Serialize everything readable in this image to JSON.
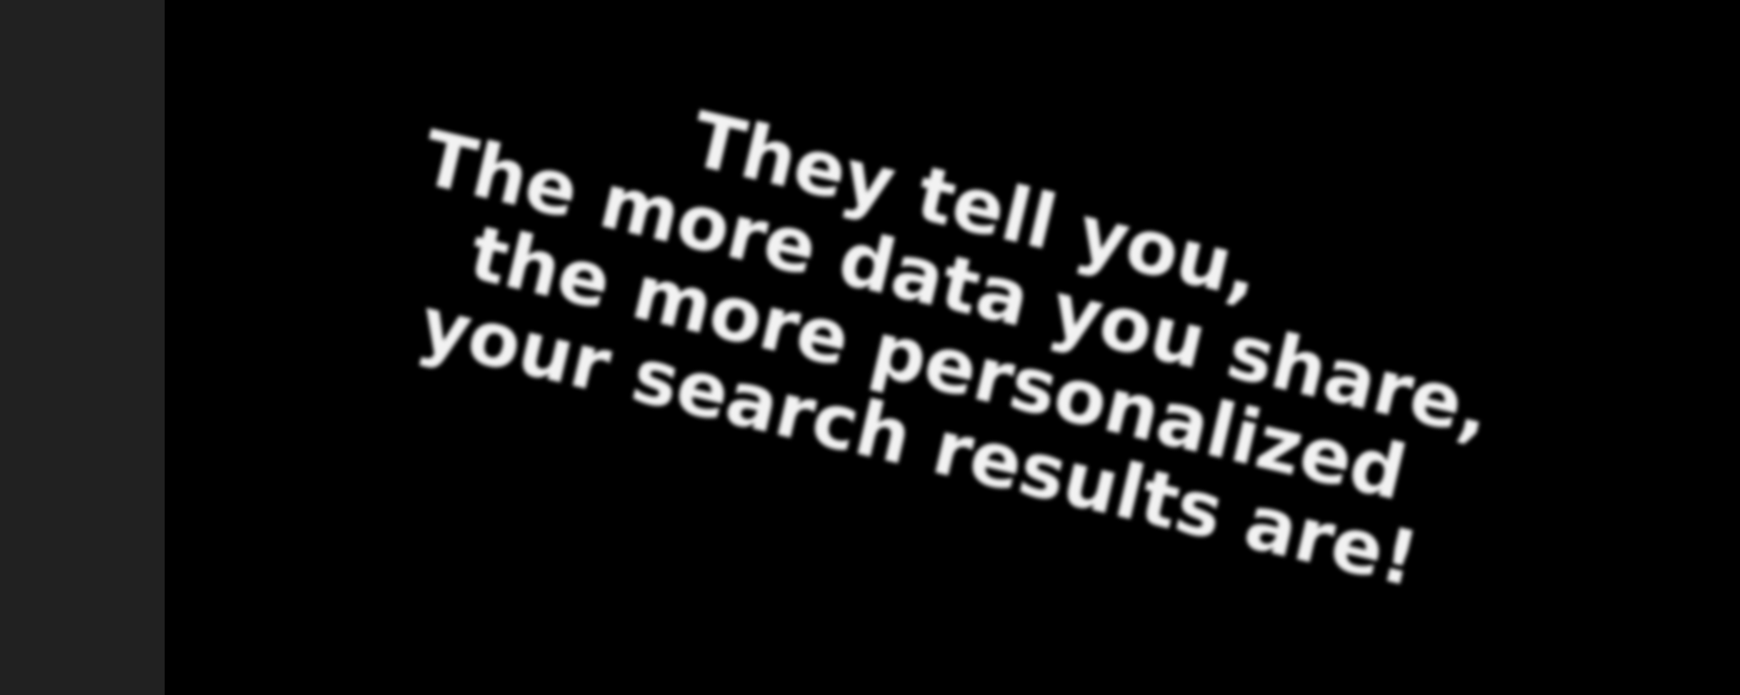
{
  "caption": {
    "lines": [
      "They tell you,",
      "The more data you share,",
      "the more personalized",
      "your search results are!"
    ]
  },
  "colors": {
    "left_panel": "#212121",
    "stage_background": "#000000",
    "text": "#f2f2f2"
  }
}
